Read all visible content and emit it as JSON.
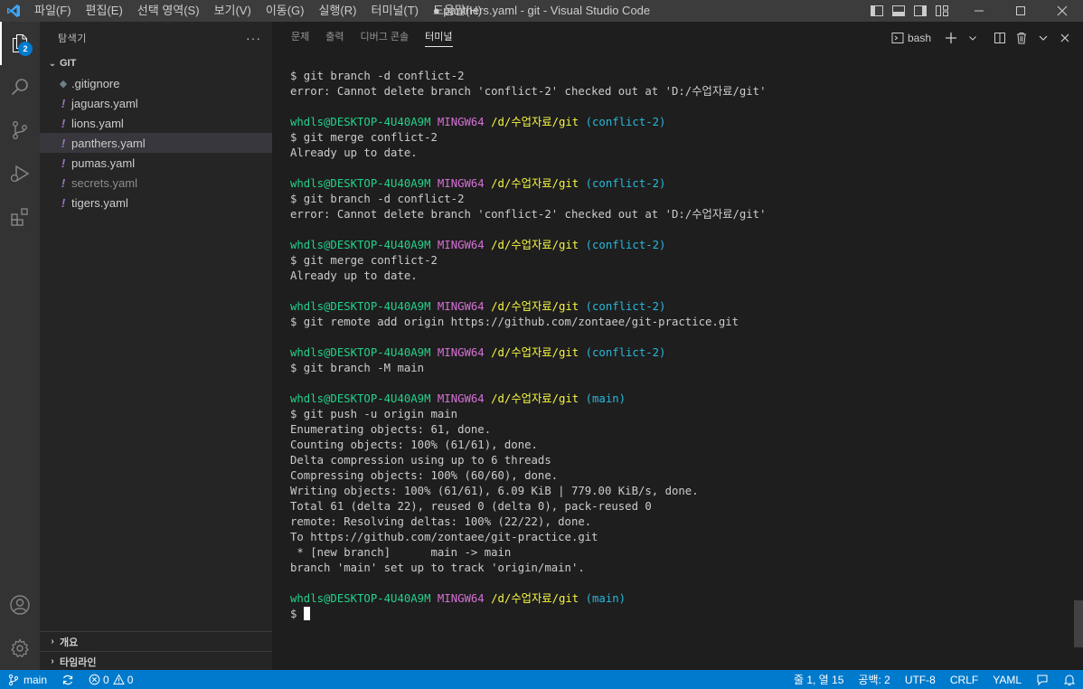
{
  "titlebar": {
    "menu": [
      "파일(F)",
      "편집(E)",
      "선택 영역(S)",
      "보기(V)",
      "이동(G)",
      "실행(R)",
      "터미널(T)",
      "도움말(H)"
    ],
    "title": "● panthers.yaml - git - Visual Studio Code"
  },
  "activitybar": {
    "explorer_badge": "2"
  },
  "sidebar": {
    "title": "탐색기",
    "more": "···",
    "folder": "GIT",
    "files": [
      {
        "name": ".gitignore",
        "icon": "git-file-icon"
      },
      {
        "name": "jaguars.yaml",
        "icon": "yaml-icon"
      },
      {
        "name": "lions.yaml",
        "icon": "yaml-icon"
      },
      {
        "name": "panthers.yaml",
        "icon": "yaml-icon"
      },
      {
        "name": "pumas.yaml",
        "icon": "yaml-icon"
      },
      {
        "name": "secrets.yaml",
        "icon": "yaml-icon"
      },
      {
        "name": "tigers.yaml",
        "icon": "yaml-icon"
      }
    ],
    "yaml_glyph": "!",
    "git_glyph": "◆",
    "outline": "개요",
    "timeline": "타임라인"
  },
  "panel": {
    "tabs": [
      "문제",
      "출력",
      "디버그 콘솔",
      "터미널"
    ],
    "active_tab": "터미널",
    "shell": "bash"
  },
  "terminal": {
    "prompt": {
      "user": "whdls@DESKTOP-4U40A9M",
      "env": "MINGW64",
      "path": "/d/수업자료/git"
    },
    "lines": [
      {
        "kind": "out",
        "text": "$ git branch -d conflict-2"
      },
      {
        "kind": "out",
        "text": "error: Cannot delete branch 'conflict-2' checked out at 'D:/수업자료/git'"
      },
      {
        "kind": "blank"
      },
      {
        "kind": "prompt",
        "branch": "(conflict-2)"
      },
      {
        "kind": "out",
        "text": "$ git merge conflict-2"
      },
      {
        "kind": "out",
        "text": "Already up to date."
      },
      {
        "kind": "blank"
      },
      {
        "kind": "prompt",
        "branch": "(conflict-2)"
      },
      {
        "kind": "out",
        "text": "$ git branch -d conflict-2"
      },
      {
        "kind": "out",
        "text": "error: Cannot delete branch 'conflict-2' checked out at 'D:/수업자료/git'"
      },
      {
        "kind": "blank"
      },
      {
        "kind": "prompt",
        "branch": "(conflict-2)"
      },
      {
        "kind": "out",
        "text": "$ git merge conflict-2"
      },
      {
        "kind": "out",
        "text": "Already up to date."
      },
      {
        "kind": "blank"
      },
      {
        "kind": "prompt",
        "branch": "(conflict-2)"
      },
      {
        "kind": "out",
        "text": "$ git remote add origin https://github.com/zontaee/git-practice.git"
      },
      {
        "kind": "blank"
      },
      {
        "kind": "prompt",
        "branch": "(conflict-2)"
      },
      {
        "kind": "out",
        "text": "$ git branch -M main"
      },
      {
        "kind": "blank"
      },
      {
        "kind": "prompt",
        "branch": "(main)"
      },
      {
        "kind": "out",
        "text": "$ git push -u origin main"
      },
      {
        "kind": "out",
        "text": "Enumerating objects: 61, done."
      },
      {
        "kind": "out",
        "text": "Counting objects: 100% (61/61), done."
      },
      {
        "kind": "out",
        "text": "Delta compression using up to 6 threads"
      },
      {
        "kind": "out",
        "text": "Compressing objects: 100% (60/60), done."
      },
      {
        "kind": "out",
        "text": "Writing objects: 100% (61/61), 6.09 KiB | 779.00 KiB/s, done."
      },
      {
        "kind": "out",
        "text": "Total 61 (delta 22), reused 0 (delta 0), pack-reused 0"
      },
      {
        "kind": "out",
        "text": "remote: Resolving deltas: 100% (22/22), done."
      },
      {
        "kind": "out",
        "text": "To https://github.com/zontaee/git-practice.git"
      },
      {
        "kind": "out",
        "text": " * [new branch]      main -> main"
      },
      {
        "kind": "out",
        "text": "branch 'main' set up to track 'origin/main'."
      },
      {
        "kind": "blank"
      },
      {
        "kind": "prompt",
        "branch": "(main)"
      },
      {
        "kind": "input",
        "text": "$ "
      }
    ]
  },
  "statusbar": {
    "branch": "main",
    "errors": "0",
    "warnings": "0",
    "position": "줄 1, 열 15",
    "indent": "공백: 2",
    "encoding": "UTF-8",
    "eol": "CRLF",
    "language": "YAML"
  },
  "colors": {
    "statusbar": "#007acc",
    "prompt_user": "#23d18b",
    "prompt_env": "#d670d6",
    "prompt_path": "#f5f543",
    "prompt_branch": "#29b8db"
  }
}
